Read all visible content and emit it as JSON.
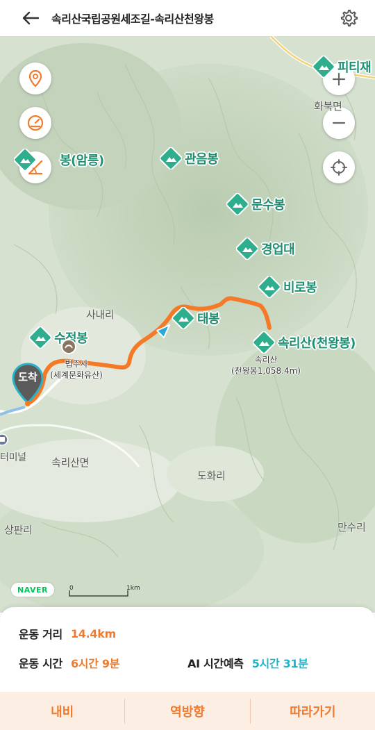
{
  "header": {
    "title": "속리산국립공원세조길-속리산천왕봉"
  },
  "map": {
    "peaks": [
      {
        "name": "관음봉"
      },
      {
        "name": "문수봉"
      },
      {
        "name": "경업대"
      },
      {
        "name": "비로봉"
      },
      {
        "name": "태봉"
      },
      {
        "name": "속리산(천왕봉)"
      },
      {
        "name": "수정봉"
      },
      {
        "name": "봉(암릉)"
      },
      {
        "name": "피티재"
      }
    ],
    "places": {
      "sanaeri": "사내리",
      "songnisanmyeon": "속리산면",
      "dohwari": "도화리",
      "sangpanri": "상판리",
      "mansuri": "만수리",
      "terminal": "터미널",
      "hwabungmyeon": "화북면",
      "beopjusa_1": "법주사",
      "beopjusa_2": "(세계문화유산)"
    },
    "summit": {
      "line1": "속리산",
      "line2": "(천왕봉1,058.4m)"
    },
    "arrival_label": "도착",
    "naver_logo": "NAVER",
    "scale": {
      "zero": "0",
      "one": "1km"
    },
    "route_color": "#f57a27"
  },
  "panel": {
    "distance_label": "운동 거리",
    "distance_value": "14.4km",
    "time_label": "운동 시간",
    "time_value": "6시간 9분",
    "ai_label": "AI 시간예측",
    "ai_value": "5시간 31분",
    "actions": {
      "navi": "내비",
      "reverse": "역방향",
      "follow": "따라가기"
    }
  },
  "colors": {
    "accent_orange": "#f07a2d",
    "accent_teal": "#1fb4c9",
    "peak_green": "#1f8f72"
  }
}
